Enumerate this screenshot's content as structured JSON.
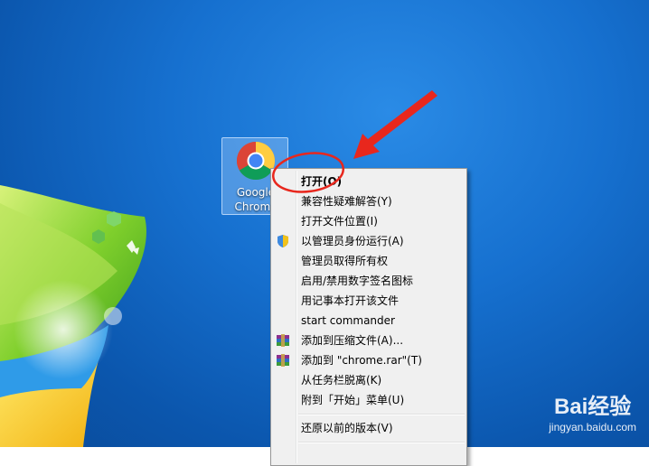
{
  "desktop": {
    "icon": {
      "label": "Google\nChrome",
      "icon_name": "chrome-icon"
    }
  },
  "context_menu": {
    "items": [
      {
        "label": "打开(O)",
        "bold": true
      },
      {
        "label": "兼容性疑难解答(Y)"
      },
      {
        "label": "打开文件位置(I)"
      },
      {
        "label": "以管理员身份运行(A)",
        "icon": "uac-shield-icon"
      },
      {
        "label": "管理员取得所有权"
      },
      {
        "label": "启用/禁用数字签名图标"
      },
      {
        "label": "用记事本打开该文件"
      },
      {
        "label": "start commander"
      },
      {
        "label": "添加到压缩文件(A)...",
        "icon": "winrar-icon"
      },
      {
        "label": "添加到 \"chrome.rar\"(T)",
        "icon": "winrar-icon"
      },
      {
        "label": "从任务栏脱离(K)"
      },
      {
        "label": "附到「开始」菜单(U)"
      },
      {
        "label": "还原以前的版本(V)"
      }
    ]
  },
  "watermark": {
    "logo_text": "Bai经验",
    "url": "jingyan.baidu.com"
  },
  "colors": {
    "annotation_red": "#e8271d",
    "menu_background": "#f0f0f0",
    "desktop_blue": "#1670cf"
  }
}
